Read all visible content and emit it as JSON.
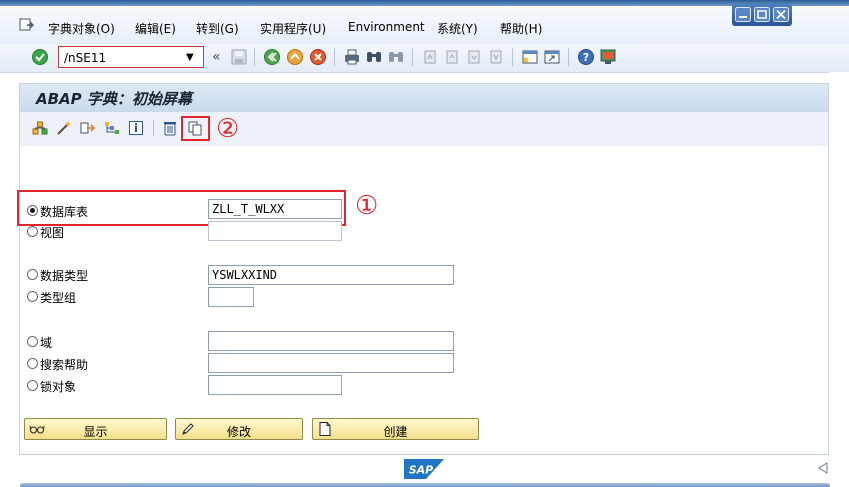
{
  "menubar": {
    "items": [
      "字典对象(O)",
      "编辑(E)",
      "转到(G)",
      "实用程序(U)",
      "Environment",
      "系统(Y)",
      "帮助(H)"
    ],
    "window_buttons": [
      "minimize",
      "maximize",
      "close"
    ]
  },
  "toolbar": {
    "command_value": "/nSE11",
    "icons": [
      "enter-icon",
      "save-icon",
      "back-icon",
      "exit-icon",
      "cancel-icon",
      "print-icon",
      "find-icon",
      "find-next-icon",
      "first-page-icon",
      "prev-page-icon",
      "next-page-icon",
      "last-page-icon",
      "new-session-icon",
      "shortcut-icon",
      "help-icon",
      "layout-icon"
    ]
  },
  "page": {
    "title": "ABAP 字典：初始屏幕"
  },
  "annotations": {
    "marker_1": "①",
    "marker_2": "②"
  },
  "form": {
    "rows": [
      {
        "label": "数据库表",
        "value": "ZLL_T_WLXX",
        "selected": true
      },
      {
        "label": "视图",
        "value": "",
        "selected": false
      },
      {
        "label": "数据类型",
        "value": "YSWLXXIND",
        "selected": false
      },
      {
        "label": "类型组",
        "value": "",
        "selected": false
      },
      {
        "label": "域",
        "value": "",
        "selected": false
      },
      {
        "label": "搜索帮助",
        "value": "",
        "selected": false
      },
      {
        "label": "锁对象",
        "value": "",
        "selected": false
      }
    ]
  },
  "buttons": {
    "display": "显示",
    "change": "修改",
    "create": "创建"
  },
  "footer": {
    "logo": "SAP"
  },
  "colors": {
    "accent_blue": "#2b5d94",
    "highlight_red": "#e0262a",
    "button_yellow": "#f2e08a"
  }
}
